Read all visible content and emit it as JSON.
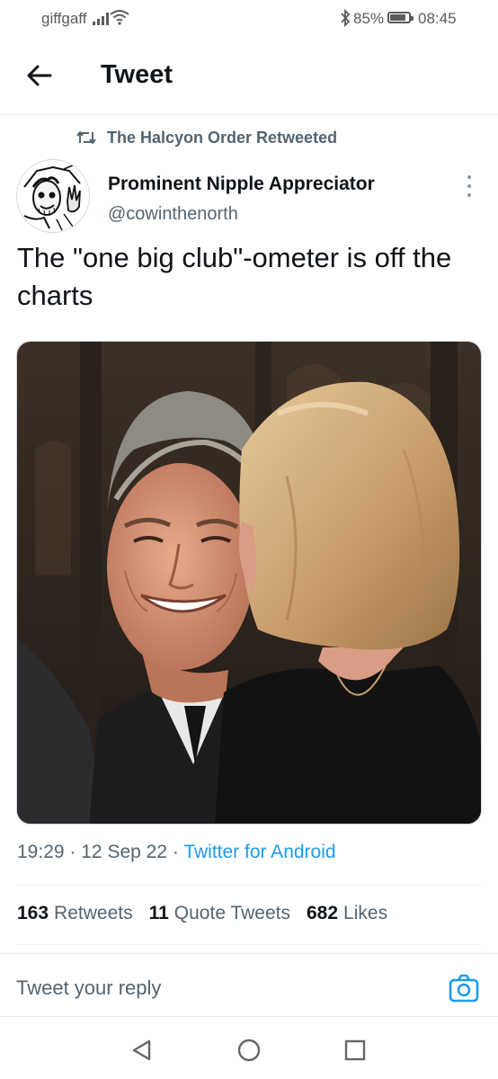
{
  "status_bar": {
    "carrier": "giffgaff",
    "battery_text": "85%",
    "battery_level": 0.85,
    "time": "08:45"
  },
  "header": {
    "title": "Tweet"
  },
  "retweet_context": {
    "text": "The Halcyon Order Retweeted"
  },
  "tweet": {
    "author_name": "Prominent Nipple Appreciator",
    "author_handle": "@cowinthenorth",
    "text": "The \"one big club\"-ometer is off the charts",
    "time": "19:29",
    "date": "12 Sep 22",
    "source": "Twitter for Android",
    "separator": "·"
  },
  "stats": {
    "retweets_count": "163",
    "retweets_label": "Retweets",
    "quote_count": "11",
    "quote_label": "Quote Tweets",
    "likes_count": "682",
    "likes_label": "Likes"
  },
  "reply": {
    "placeholder": "Tweet your reply"
  },
  "icons": {
    "back": "arrow-left-icon",
    "retweet": "retweet-icon",
    "more": "more-vertical-icon",
    "camera": "camera-icon",
    "nav_back": "triangle-back-icon",
    "nav_home": "circle-home-icon",
    "nav_recents": "square-recents-icon"
  },
  "colors": {
    "accent": "#1d9bf0",
    "secondary_text": "#536471",
    "primary_text": "#0f1419"
  }
}
